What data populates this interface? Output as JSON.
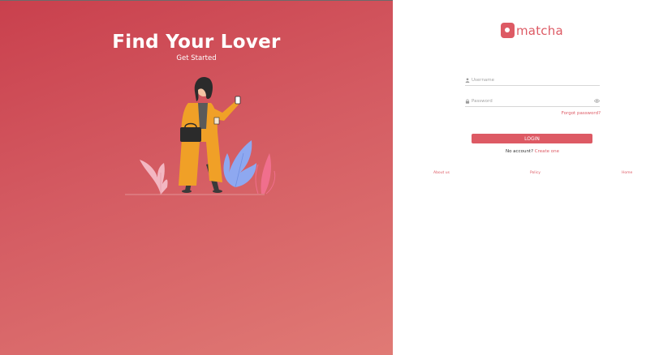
{
  "hero": {
    "title": "Find Your Lover",
    "subtitle": "Get Started",
    "illustration": "woman-walking-with-phone-and-coffee"
  },
  "brand": {
    "name": "matcha",
    "accent_color": "#dd5a64",
    "panel_gradient": [
      "#c9404d",
      "#e07a75"
    ]
  },
  "form": {
    "username_placeholder": "Username",
    "password_placeholder": "Password",
    "forgot_label": "Forgot password?",
    "login_label": "LOGIN",
    "no_account_text": "No account?",
    "create_label": "Create one"
  },
  "footer": {
    "about": "About us",
    "policy": "Policy",
    "home": "Home"
  },
  "icons": {
    "username": "user-icon",
    "password": "lock-icon",
    "reveal": "eye-icon"
  }
}
